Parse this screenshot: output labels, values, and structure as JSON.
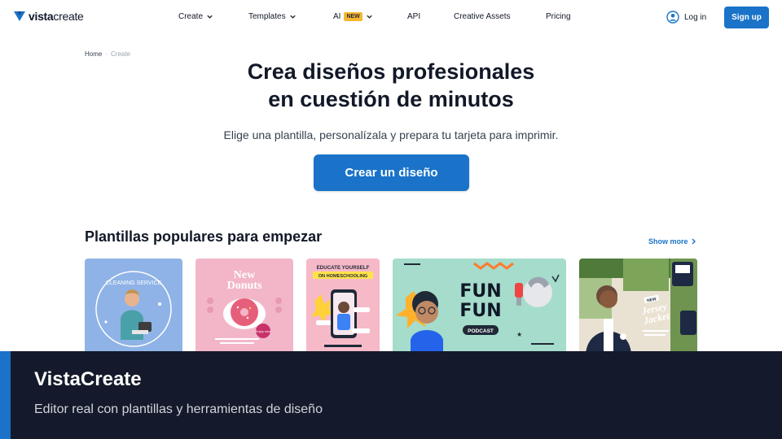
{
  "brand": {
    "name_bold": "vista",
    "name_light": "create",
    "accent": "#1a73c8"
  },
  "nav": {
    "items": [
      {
        "label": "Create",
        "chevron": true
      },
      {
        "label": "Templates",
        "chevron": true
      },
      {
        "label": "AI",
        "badge": "NEW",
        "chevron": true
      },
      {
        "label": "API",
        "chevron": false
      },
      {
        "label": "Creative Assets",
        "chevron": false
      },
      {
        "label": "Pricing",
        "chevron": false
      }
    ],
    "login_label": "Log in",
    "signup_label": "Sign up"
  },
  "breadcrumb": {
    "home": "Home",
    "separator": "·",
    "current": "Create"
  },
  "hero": {
    "title_line1": "Crea diseños profesionales",
    "title_line2": "en cuestión de minutos",
    "subtitle": "Elige una plantilla, personalízala y prepara tu tarjeta para imprimir.",
    "cta_label": "Crear un diseño"
  },
  "templates": {
    "title": "Plantillas populares para empezar",
    "show_more": "Show more",
    "cards": [
      {
        "name": "cleaning-service",
        "text": "CLEANING SERVICE",
        "bg": "#8fb3e6"
      },
      {
        "name": "new-donuts",
        "text_line1": "New",
        "text_line2": "Donuts",
        "sticker": "Enjoy now",
        "bg": "#f2b6c8"
      },
      {
        "name": "homeschooling",
        "text_line1": "EDUCATE YOURSELF",
        "text_line2": "ON HOMESCHOOLING",
        "bg": "#f6b9c8"
      },
      {
        "name": "fun-fun-podcast",
        "text_line1": "FUN",
        "text_line2": "FUN",
        "tag": "PODCAST",
        "bg": "#a5dccb"
      },
      {
        "name": "jersey-jacket",
        "tag": "NEW",
        "text_line1": "Jersey",
        "text_line2": "Jacket",
        "bg": "#7da55a"
      }
    ]
  },
  "overlay": {
    "title": "VistaCreate",
    "description": "Editor real con plantillas y herramientas de diseño"
  }
}
